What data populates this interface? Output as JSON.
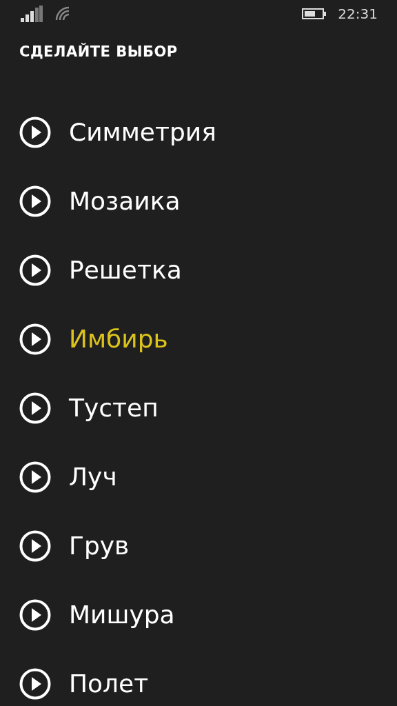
{
  "status_bar": {
    "time": "22:31"
  },
  "title": "СДЕЛАЙТЕ ВЫБОР",
  "items": [
    {
      "label": "Симметрия",
      "selected": false
    },
    {
      "label": "Мозаика",
      "selected": false
    },
    {
      "label": "Решетка",
      "selected": false
    },
    {
      "label": "Имбирь",
      "selected": true
    },
    {
      "label": "Тустеп",
      "selected": false
    },
    {
      "label": "Луч",
      "selected": false
    },
    {
      "label": "Грув",
      "selected": false
    },
    {
      "label": "Мишура",
      "selected": false
    },
    {
      "label": "Полет",
      "selected": false
    }
  ]
}
